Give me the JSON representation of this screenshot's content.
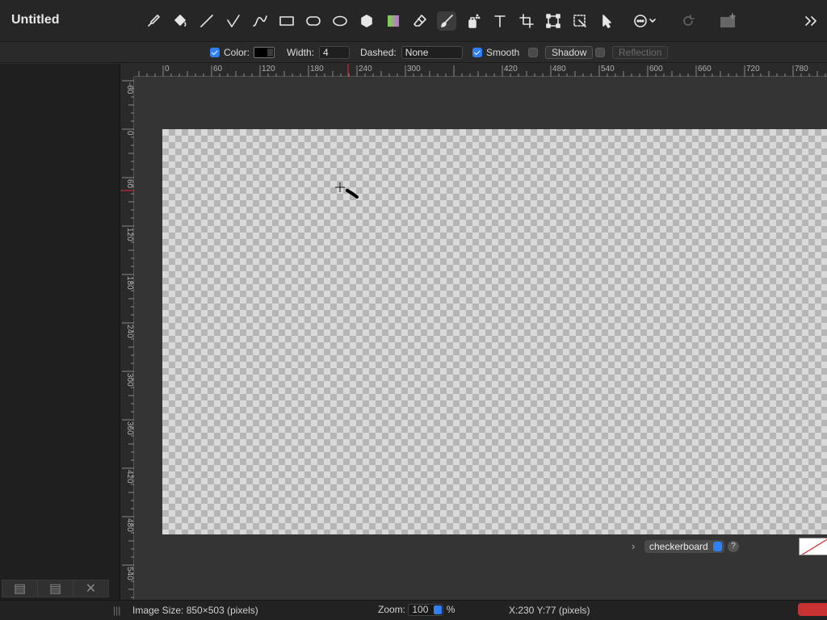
{
  "window": {
    "title": "Untitled"
  },
  "toolbar": {
    "tools": [
      "eyedropper-icon",
      "paint-bucket-icon",
      "line-icon",
      "angle-line-icon",
      "curve-icon",
      "rectangle-icon",
      "rounded-rectangle-icon",
      "ellipse-icon",
      "polygon-icon",
      "gradient-icon",
      "eraser-icon",
      "brush-icon",
      "spray-icon",
      "text-icon",
      "crop-icon",
      "transform-icon",
      "magic-select-icon",
      "pointer-icon",
      "more-icon",
      "redo-icon",
      "image-add-icon",
      "expand-icon"
    ],
    "active_tool": "brush-icon"
  },
  "options": {
    "color_label": "Color:",
    "color_value": "#000000",
    "width_label": "Width:",
    "width_value": "4",
    "dashed_label": "Dashed:",
    "dashed_value": "None",
    "smooth_label": "Smooth",
    "smooth_checked": true,
    "shadow_label": "Shadow",
    "shadow_checked": false,
    "reflection_label": "Reflection",
    "reflection_checked": false
  },
  "rulers": {
    "horizontal_labels": [
      "0",
      "60",
      "120",
      "180",
      "240",
      "300",
      "420",
      "480",
      "540",
      "600",
      "660",
      "720",
      "780"
    ],
    "vertical_labels": [
      "-60",
      "0",
      "60",
      "120",
      "180",
      "240",
      "300",
      "360",
      "420",
      "480",
      "540"
    ]
  },
  "canvas": {
    "background_mode": "checkerboard",
    "help_label": "?"
  },
  "status": {
    "image_size": "Image Size: 850×503 (pixels)",
    "zoom_label": "Zoom:",
    "zoom_value": "100",
    "zoom_unit": "%",
    "cursor_position": "X:230 Y:77 (pixels)"
  },
  "colors": {
    "accent": "#2f7ff6",
    "panel": "#1f1f1f",
    "work": "#343434",
    "ruler_marker": "#e03030"
  }
}
